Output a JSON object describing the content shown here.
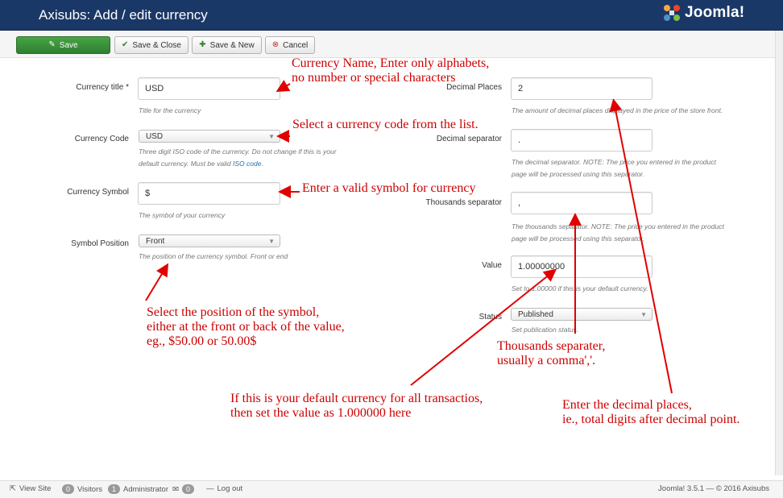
{
  "header": {
    "title": "Axisubs: Add / edit currency",
    "logo_text": "Joomla!"
  },
  "toolbar": {
    "save_label": "Save",
    "save_close_label": "Save & Close",
    "save_new_label": "Save & New",
    "cancel_label": "Cancel"
  },
  "form_left": {
    "title_label": "Currency title *",
    "title_value": "USD",
    "title_help": "Title for the currency",
    "code_label": "Currency Code",
    "code_value": "USD",
    "code_help_1": "Three digit ISO code of the currency. Do not change if this is your",
    "code_help_2": "default currency. Must be valid ",
    "code_help_link": "ISO code",
    "code_help_end": ".",
    "symbol_label": "Currency Symbol",
    "symbol_value": "$",
    "symbol_help": "The symbol of your currency",
    "position_label": "Symbol Position",
    "position_value": "Front",
    "position_help": "The position of the currency symbol. Front or end"
  },
  "form_right": {
    "decimal_places_label": "Decimal Places",
    "decimal_places_value": "2",
    "decimal_places_help": "The amount of decimal places displayed in the price of the store front.",
    "decimal_sep_label": "Decimal separator",
    "decimal_sep_value": ".",
    "decimal_sep_help_1": "The decimal separator. NOTE: The price you entered in the product",
    "decimal_sep_help_2": "page will be processed using this separator.",
    "thousands_sep_label": "Thousands separator",
    "thousands_sep_value": ",",
    "thousands_sep_help_1": "The thousands separator. NOTE: The price you entered in the product",
    "thousands_sep_help_2": "page will be processed using this separator.",
    "value_label": "Value",
    "value_value": "1.00000000",
    "value_help": "Set to 1.00000 if this is your default currency.",
    "status_label": "Status",
    "status_value": "Published",
    "status_help": "Set publication status."
  },
  "annotations": {
    "name_1": "Currency Name, Enter only alphabets,",
    "name_2": "no number or special characters",
    "code": "Select a currency code from the list.",
    "symbol": "Enter a valid symbol for currency",
    "position_1": "Select the position of the symbol,",
    "position_2": "either at the front or back of the value,",
    "position_3": "eg., $50.00 or 50.00$",
    "thousands_1": "Thousands separater,",
    "thousands_2": "usually a comma','.",
    "value_1": "If this is your default currency for all transactios,",
    "value_2": "then set the value as 1.000000 here",
    "decimal_1": "Enter the decimal places,",
    "decimal_2": "ie., total digits after decimal point."
  },
  "footer": {
    "view_site": "View Site",
    "visitors_count": "0",
    "visitors_label": "Visitors",
    "admin_count": "1",
    "admin_label": "Administrator",
    "messages_count": "0",
    "logout": "Log out",
    "version": "Joomla! 3.5.1 — © 2016 Axisubs"
  },
  "colors": {
    "header_bg": "#1a3867",
    "save_green": "#3a913a",
    "annotation_red": "#cc0000"
  },
  "icons": [
    "joomla-logo-icon",
    "edit-icon",
    "check-icon",
    "plus-icon",
    "cancel-icon",
    "external-link-icon",
    "mail-icon"
  ]
}
